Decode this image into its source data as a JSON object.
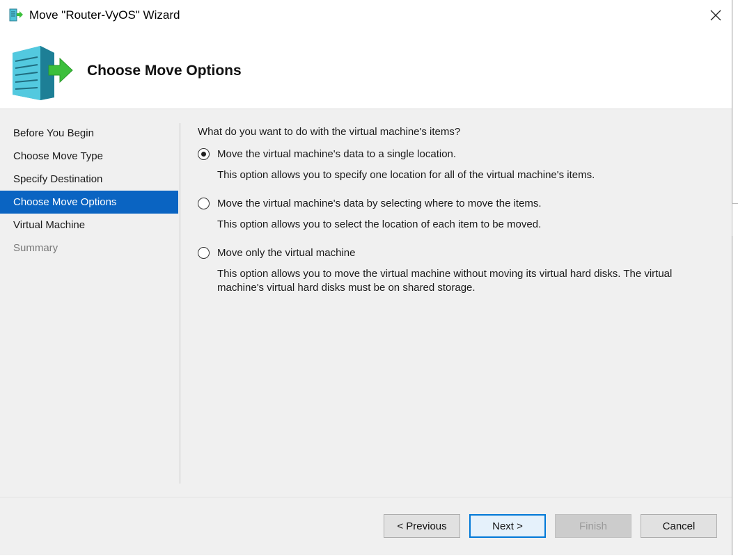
{
  "window": {
    "title": "Move \"Router-VyOS\" Wizard",
    "close_icon": "close-icon"
  },
  "header": {
    "title": "Choose Move Options",
    "icon": "server-move-icon"
  },
  "nav": {
    "items": [
      {
        "label": "Before You Begin",
        "state": "normal"
      },
      {
        "label": "Choose Move Type",
        "state": "normal"
      },
      {
        "label": "Specify Destination",
        "state": "normal"
      },
      {
        "label": "Choose Move Options",
        "state": "active"
      },
      {
        "label": "Virtual Machine",
        "state": "normal"
      },
      {
        "label": "Summary",
        "state": "disabled"
      }
    ]
  },
  "content": {
    "question": "What do you want to do with the virtual machine's items?",
    "options": [
      {
        "label": "Move the virtual machine's data to a single location.",
        "description": "This option allows you to specify one location for all of the virtual machine's items.",
        "selected": true
      },
      {
        "label": "Move the virtual machine's data by selecting where to move the items.",
        "description": "This option allows you to select the location of each item to be moved.",
        "selected": false
      },
      {
        "label": "Move only the virtual machine",
        "description": "This option allows you to move the virtual machine without moving its virtual hard disks. The virtual machine's virtual hard disks must be on shared storage.",
        "selected": false
      }
    ]
  },
  "footer": {
    "previous_label": "< Previous",
    "next_label": "Next >",
    "finish_label": "Finish",
    "cancel_label": "Cancel"
  },
  "colors": {
    "accent": "#0a64c2",
    "panel": "#f0f0f0",
    "server_teal": "#4fc3d9",
    "arrow_green": "#3cbf3c"
  }
}
